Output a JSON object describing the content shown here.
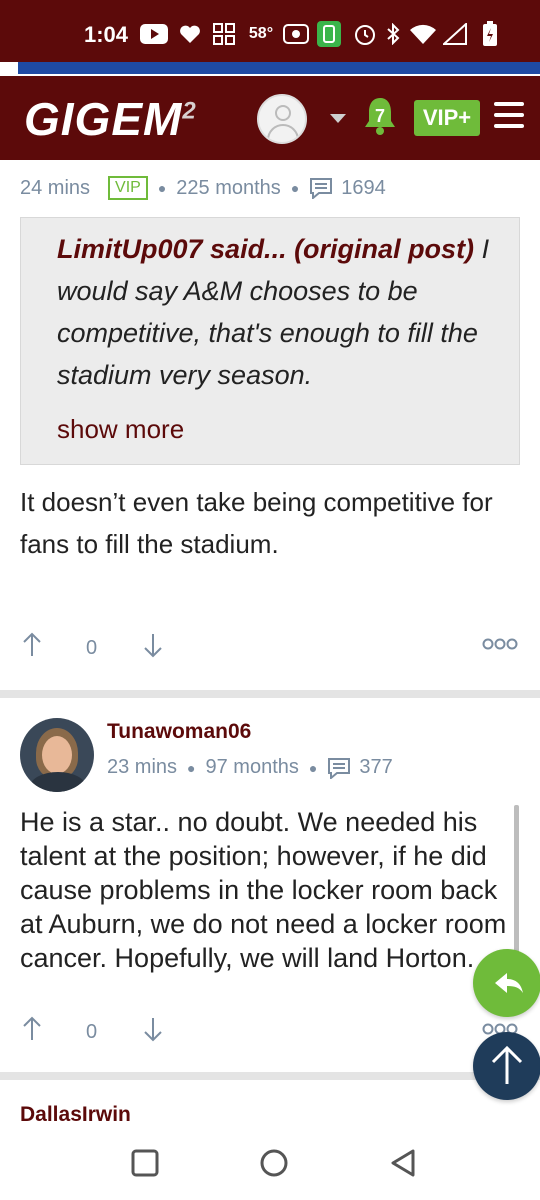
{
  "status_bar": {
    "time": "1:04",
    "temperature": "58°",
    "icons": [
      "youtube-icon",
      "heart-icon",
      "grid-icon",
      "radio-icon",
      "battery-saver-icon",
      "alarm-icon",
      "bluetooth-icon",
      "wifi-icon",
      "signal-icon",
      "battery-icon"
    ]
  },
  "header": {
    "logo_text": "GIGEM",
    "logo_sup": "2",
    "notification_count": "7",
    "vip_button": "VIP+",
    "icons": [
      "avatar-icon",
      "caret-down-icon",
      "bell-icon",
      "menu-icon"
    ]
  },
  "posts": [
    {
      "time": "24 mins",
      "badge": "VIP",
      "tenure": "225 months",
      "post_count": "1694",
      "quote": {
        "author_prefix": "LimitUp007 said... (original post)",
        "text": " I would say A&M chooses to be competitive, that's enough to fill the stadium very season.",
        "show_more": "show more"
      },
      "body": "It doesn’t even take being competitive for fans to fill the stadium.",
      "votes": "0"
    },
    {
      "username": "Tunawoman06",
      "time": "23 mins",
      "tenure": "97 months",
      "post_count": "377",
      "body": "He is a star.. no doubt. We needed his talent at the position; however, if he did cause problems in the locker room back at Auburn, we do not need a locker room cancer. Hopefully, we will land Horton.",
      "votes": "0"
    },
    {
      "username": "DallasIrwin"
    }
  ],
  "colors": {
    "maroon": "#5c0a0a",
    "green": "#6fbb3a",
    "navy": "#1f3c5a",
    "meta_gray": "#7a8ca0"
  }
}
